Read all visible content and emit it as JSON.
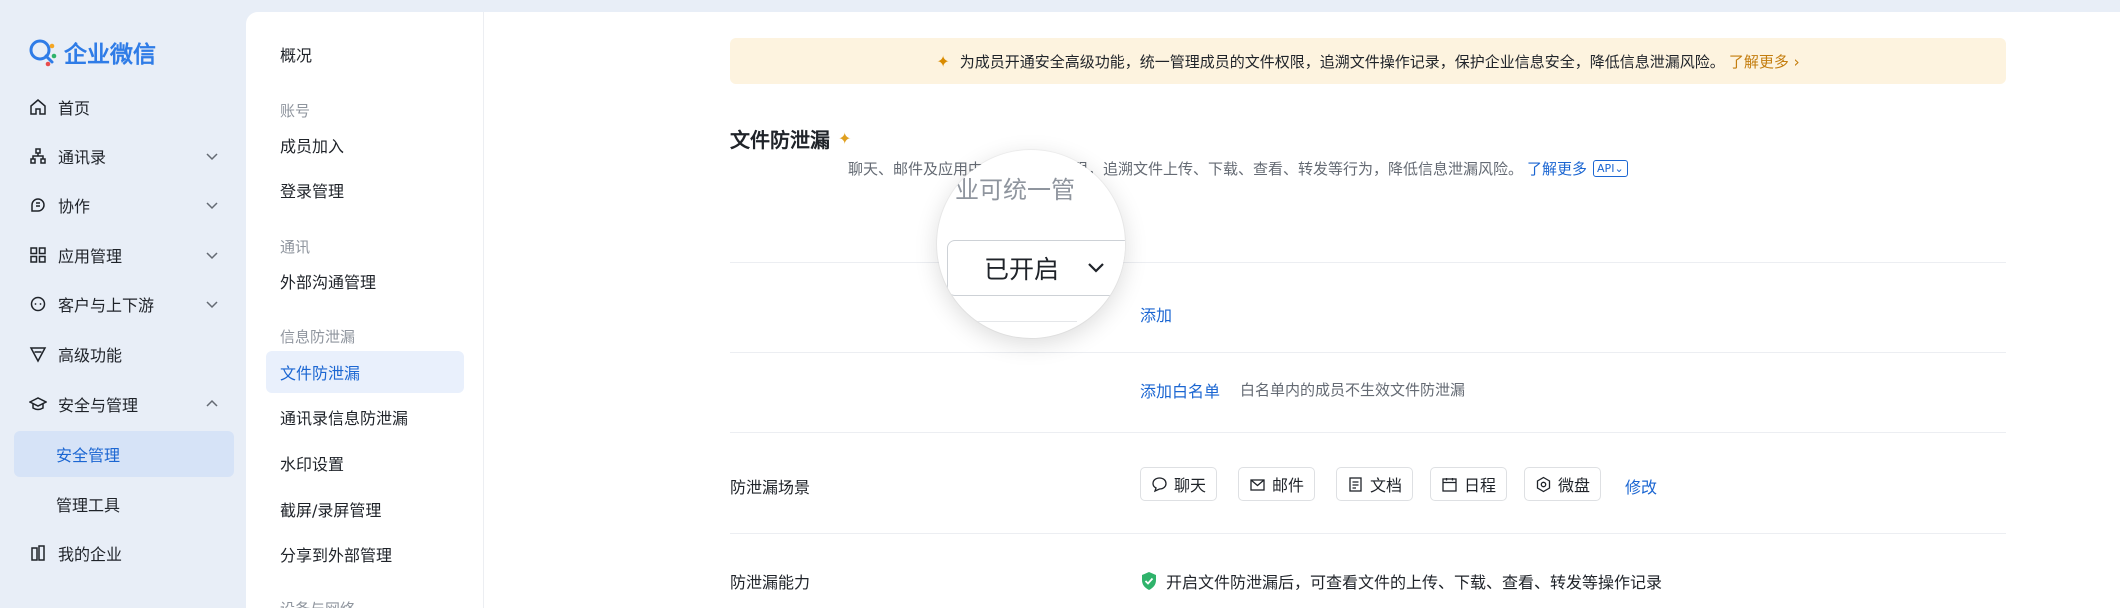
{
  "app": {
    "logo_text": "企业微信",
    "accent_color": "#1b66d2"
  },
  "nav": {
    "items": [
      {
        "label": "首页",
        "icon": "home-icon"
      },
      {
        "label": "通讯录",
        "icon": "org-icon"
      },
      {
        "label": "协作",
        "icon": "collab-icon"
      },
      {
        "label": "应用管理",
        "icon": "apps-icon"
      },
      {
        "label": "客户与上下游",
        "icon": "chat-bubble-icon"
      },
      {
        "label": "高级功能",
        "icon": "filter-icon"
      },
      {
        "label": "安全与管理",
        "icon": "graduation-icon"
      },
      {
        "label": "我的企业",
        "icon": "building-icon"
      }
    ],
    "sub_items": [
      "安全管理",
      "管理工具"
    ]
  },
  "subnav": {
    "overview": "概况",
    "groups": {
      "account": "账号",
      "comm": "通讯",
      "leak": "信息防泄漏",
      "device": "设备与网络"
    },
    "items": {
      "join": "成员加入",
      "login": "登录管理",
      "external": "外部沟通管理",
      "file_leak": "文件防泄漏",
      "contacts_leak": "通讯录信息防泄漏",
      "watermark": "水印设置",
      "screenshot": "截屏/录屏管理",
      "share_external": "分享到外部管理"
    }
  },
  "banner": {
    "text": "为成员开通安全高级功能，统一管理成员的文件权限，追溯文件操作记录，保护企业信息安全，降低信息泄漏风险。",
    "more": "了解更多"
  },
  "page": {
    "title": "文件防泄漏",
    "desc_visible": "聊天、邮件及应用中的文件操作权限，追溯文件上传、下载、查看、转发等行为，降低信息泄漏风险。",
    "desc_more": "了解更多",
    "api": "API"
  },
  "magnifier": {
    "text": "业可统一管",
    "select_value": "已开启"
  },
  "rows": {
    "add": "添加",
    "whitelist_add": "添加白名单",
    "whitelist_hint": "白名单内的成员不生效文件防泄漏",
    "scene_label": "防泄漏场景",
    "scenes": [
      {
        "label": "聊天",
        "icon": "chat-icon"
      },
      {
        "label": "邮件",
        "icon": "mail-icon"
      },
      {
        "label": "文档",
        "icon": "doc-icon"
      },
      {
        "label": "日程",
        "icon": "calendar-icon"
      },
      {
        "label": "微盘",
        "icon": "drive-icon"
      }
    ],
    "modify": "修改",
    "ability_label": "防泄漏能力",
    "ability_text": "开启文件防泄漏后，可查看文件的上传、下载、查看、转发等操作记录"
  }
}
